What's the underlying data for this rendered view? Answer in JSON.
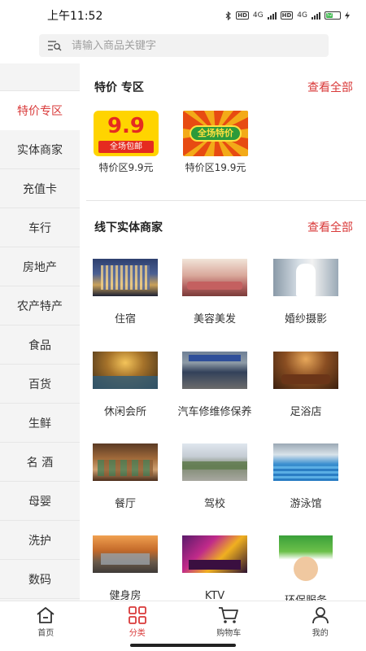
{
  "status_bar": {
    "time": "上午11:52",
    "bt_icon": "bluetooth-icon",
    "hd_label": "HD",
    "net_label_1": "4G",
    "net_label_2": "4G",
    "battery": "52",
    "battery_level": 0.52,
    "battery_color": "#39b54a"
  },
  "search": {
    "placeholder": "请输入商品关键字",
    "icon": "search-list-icon"
  },
  "sidebar": {
    "items": [
      {
        "label": "特价专区",
        "active": true
      },
      {
        "label": "实体商家"
      },
      {
        "label": "充值卡"
      },
      {
        "label": "车行"
      },
      {
        "label": "房地产"
      },
      {
        "label": "农产特产"
      },
      {
        "label": "食品"
      },
      {
        "label": "百货"
      },
      {
        "label": "生鲜"
      },
      {
        "label": "名 酒"
      },
      {
        "label": "母婴"
      },
      {
        "label": "洗护"
      },
      {
        "label": "数码"
      }
    ]
  },
  "special": {
    "title": "特价 专区",
    "view_all": "查看全部",
    "items": [
      {
        "label": "特价区9.9元",
        "img_big": "9.9",
        "img_small": "全场包邮"
      },
      {
        "label": "特价区19.9元",
        "img_text": "全场特价"
      }
    ]
  },
  "merchants": {
    "title": "线下实体商家",
    "view_all": "查看全部",
    "items": [
      {
        "label": "住宿"
      },
      {
        "label": "美容美发"
      },
      {
        "label": "婚纱摄影"
      },
      {
        "label": "休闲会所"
      },
      {
        "label": "汽车修维修保养"
      },
      {
        "label": "足浴店"
      },
      {
        "label": "餐厅"
      },
      {
        "label": "驾校"
      },
      {
        "label": "游泳馆"
      },
      {
        "label": "健身房"
      },
      {
        "label": "KTV"
      },
      {
        "label": "环保服务"
      }
    ]
  },
  "bottom_nav": {
    "items": [
      {
        "label": "首页",
        "icon": "home-icon"
      },
      {
        "label": "分类",
        "icon": "category-grid-icon",
        "active": true
      },
      {
        "label": "购物车",
        "icon": "cart-icon"
      },
      {
        "label": "我的",
        "icon": "user-icon"
      }
    ]
  },
  "colors": {
    "accent": "#d93a3a",
    "sidebar_bg": "#f4f4f4"
  }
}
